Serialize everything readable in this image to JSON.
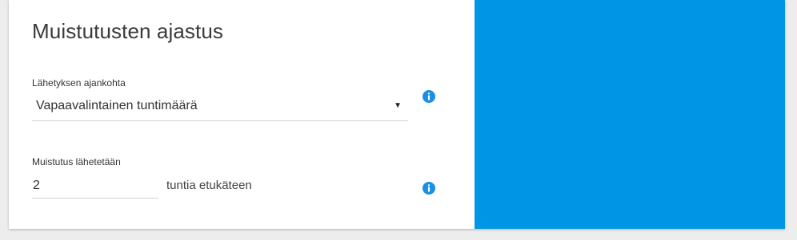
{
  "card": {
    "title": "Muistutusten ajastus"
  },
  "send_time": {
    "label": "Lähetyksen ajankohta",
    "selected": "Vapaavalintainen tuntimäärä",
    "caret": "▼"
  },
  "reminder": {
    "label": "Muistutus lähetetään",
    "value": "2",
    "suffix": "tuntia etukäteen"
  },
  "colors": {
    "accent": "#0096e6",
    "info_icon": "#1a8fe3"
  },
  "icons": {
    "info": "info-icon",
    "dropdown": "chevron-down-icon"
  }
}
